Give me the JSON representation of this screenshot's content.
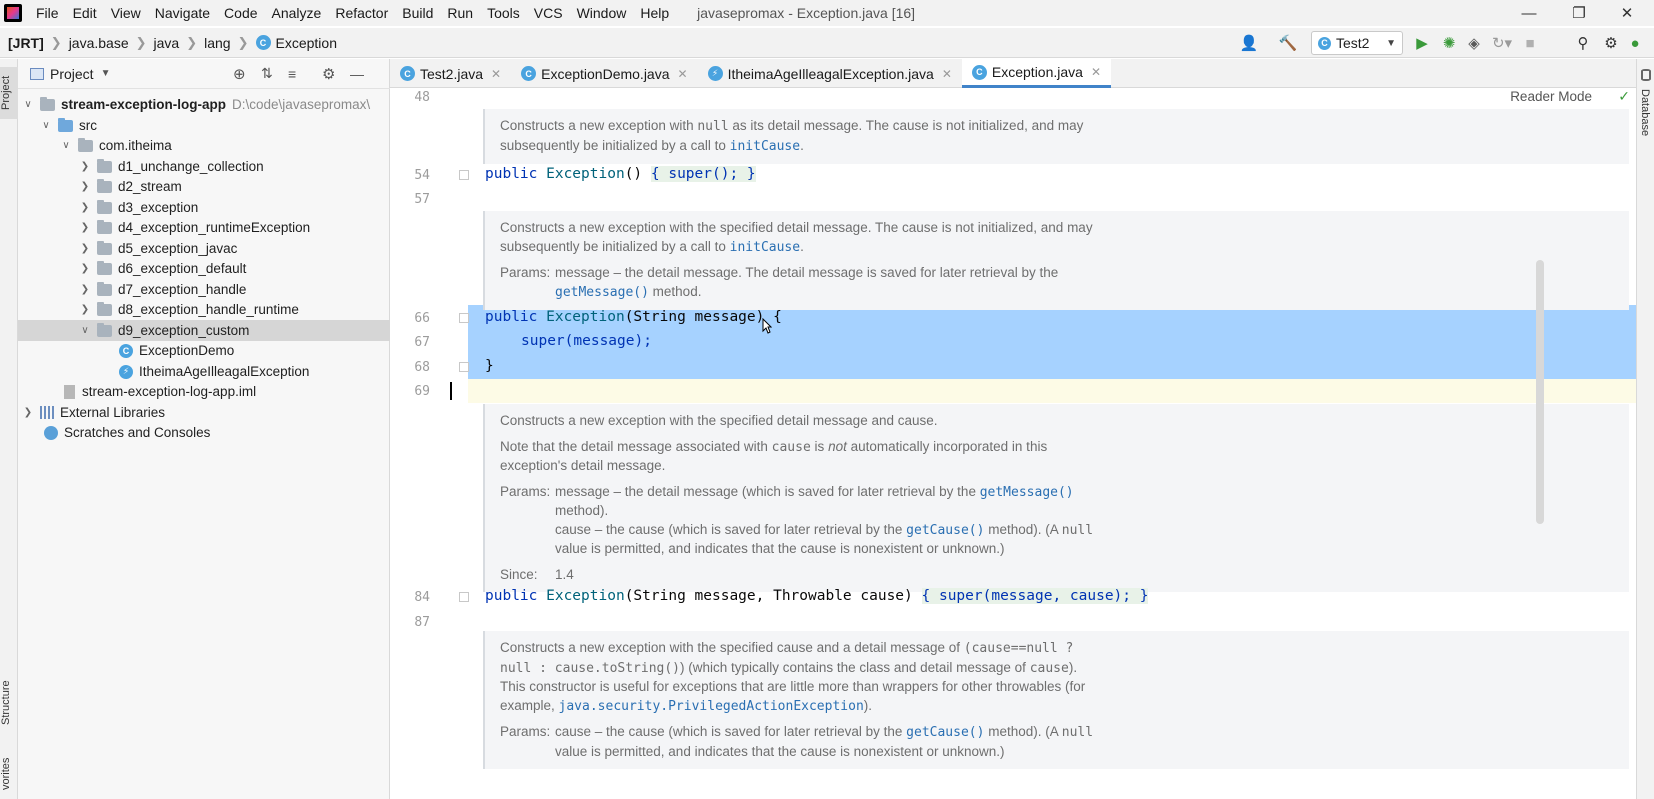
{
  "menubar": {
    "items": [
      "File",
      "Edit",
      "View",
      "Navigate",
      "Code",
      "Analyze",
      "Refactor",
      "Build",
      "Run",
      "Tools",
      "VCS",
      "Window",
      "Help"
    ],
    "window_title": "javasepromax - Exception.java [16]"
  },
  "breadcrumb": {
    "items": [
      "[JRT]",
      "java.base",
      "java",
      "lang",
      "Exception"
    ]
  },
  "toolbar": {
    "run_config": "Test2"
  },
  "side_tabs": {
    "project": "Project",
    "structure": "Structure",
    "favorites": "vorites",
    "database": "Database"
  },
  "project": {
    "title": "Project",
    "tree": [
      {
        "label": "stream-exception-log-app",
        "hint": "D:\\code\\javasepromax\\",
        "kind": "module",
        "expanded": true
      },
      {
        "label": "src",
        "kind": "src",
        "expanded": true
      },
      {
        "label": "com.itheima",
        "kind": "pkg",
        "expanded": true
      },
      {
        "label": "d1_unchange_collection",
        "kind": "pkg"
      },
      {
        "label": "d2_stream",
        "kind": "pkg"
      },
      {
        "label": "d3_exception",
        "kind": "pkg"
      },
      {
        "label": "d4_exception_runtimeException",
        "kind": "pkg"
      },
      {
        "label": "d5_exception_javac",
        "kind": "pkg"
      },
      {
        "label": "d6_exception_default",
        "kind": "pkg"
      },
      {
        "label": "d7_exception_handle",
        "kind": "pkg"
      },
      {
        "label": "d8_exception_handle_runtime",
        "kind": "pkg"
      },
      {
        "label": "d9_exception_custom",
        "kind": "pkg",
        "expanded": true
      },
      {
        "label": "ExceptionDemo",
        "kind": "class"
      },
      {
        "label": "ItheimaAgeIlleagalException",
        "kind": "exception"
      },
      {
        "label": "stream-exception-log-app.iml",
        "kind": "file"
      },
      {
        "label": "External Libraries",
        "kind": "lib"
      },
      {
        "label": "Scratches and Consoles",
        "kind": "scratch"
      }
    ]
  },
  "tabs": [
    {
      "label": "Test2.java",
      "active": false
    },
    {
      "label": "ExceptionDemo.java",
      "active": false
    },
    {
      "label": "ItheimaAgeIlleagalException.java",
      "active": false
    },
    {
      "label": "Exception.java",
      "active": true
    }
  ],
  "editor": {
    "reader_mode": "Reader Mode",
    "line_numbers": [
      "48",
      "54",
      "57",
      "66",
      "67",
      "68",
      "69",
      "84",
      "87"
    ],
    "doc1": {
      "line1_a": "Constructs a new exception with ",
      "line1_code": "null",
      "line1_b": " as its detail message. The cause is not initialized, and may",
      "line2_a": "subsequently be initialized by a call to ",
      "line2_link": "initCause",
      "line2_b": "."
    },
    "code54": {
      "kw": "public ",
      "name": "Exception",
      "rest": "() ",
      "body": "{ super(); }"
    },
    "doc2": {
      "line1": "Constructs a new exception with the specified detail message. The cause is not initialized, and may",
      "line2_a": "subsequently be initialized by a call to ",
      "line2_link": "initCause",
      "line2_b": ".",
      "params_label": "Params:",
      "params1": "message – the detail message. The detail message is saved for later retrieval by the",
      "params2_link": "getMessage()",
      "params2_b": " method."
    },
    "code66": {
      "kw": "public ",
      "name": "Exception",
      "rest": "(String message) {"
    },
    "code67": {
      "text": "super(message);"
    },
    "code68": {
      "text": "}"
    },
    "doc3": {
      "line1": "Constructs a new exception with the specified detail message and cause.",
      "note_a": "Note that the detail message associated with ",
      "note_code": "cause",
      "note_b": " is ",
      "note_em": "not",
      "note_c": " automatically incorporated in this",
      "note2": "exception's detail message.",
      "params_label": "Params:",
      "p1_a": "message – the detail message (which is saved for later retrieval by the ",
      "p1_link": "getMessage()",
      "p1_b": "method).",
      "p2_a": "cause – the cause (which is saved for later retrieval by the ",
      "p2_link": "getCause()",
      "p2_b": " method). (A ",
      "p2_code": "null",
      "p2_c": "value is permitted, and indicates that the cause is nonexistent or unknown.)",
      "since_label": "Since:",
      "since_value": "1.4"
    },
    "code84": {
      "kw": "public ",
      "name": "Exception",
      "rest": "(String message, Throwable cause) ",
      "body": "{ super(message, cause); }"
    },
    "doc4": {
      "line1_a": "Constructs a new exception with the specified cause and a detail message of ",
      "line1_code": "(cause==null ?",
      "line2_code": "null : cause.toString()",
      "line2_b": ") (which typically contains the class and detail message of ",
      "line2_code2": "cause",
      "line2_c": ").",
      "line3": "This constructor is useful for exceptions that are little more than wrappers for other throwables (for",
      "line4_a": "example, ",
      "line4_link": "java.security.PrivilegedActionException",
      "line4_b": ").",
      "params_label": "Params:",
      "p1_a": "cause – the cause (which is saved for later retrieval by the ",
      "p1_link": "getCause()",
      "p1_b": " method). (A ",
      "p1_code": "null",
      "p2": "value is permitted, and indicates that the cause is nonexistent or unknown.)"
    }
  },
  "colors": {
    "accent": "#4083c9",
    "selection": "#a6d2ff",
    "keyword": "#0033b3",
    "method": "#00627a"
  }
}
